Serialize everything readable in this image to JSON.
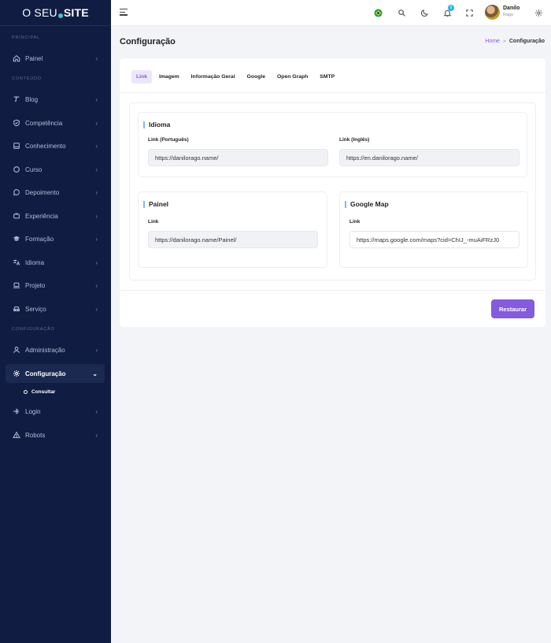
{
  "brand": {
    "part1": "O SEU",
    "part2": "SITE"
  },
  "sidebar": {
    "cat_principal": "PRINCIPAL",
    "cat_conteudo": "CONTEÚDO",
    "cat_configuracao": "CONFIGURAÇÃO",
    "items": [
      {
        "label": "Painel",
        "icon": "home-icon"
      },
      {
        "label": "Blog",
        "icon": "text-icon"
      },
      {
        "label": "Competência",
        "icon": "shield-icon"
      },
      {
        "label": "Conhecimento",
        "icon": "book-icon"
      },
      {
        "label": "Curso",
        "icon": "circle-icon"
      },
      {
        "label": "Depoimento",
        "icon": "chat-icon"
      },
      {
        "label": "Experiência",
        "icon": "briefcase-icon"
      },
      {
        "label": "Formação",
        "icon": "graduation-icon"
      },
      {
        "label": "Idioma",
        "icon": "translate-icon"
      },
      {
        "label": "Projeto",
        "icon": "laptop-icon"
      },
      {
        "label": "Serviço",
        "icon": "car-icon"
      },
      {
        "label": "Administração",
        "icon": "user-icon"
      },
      {
        "label": "Configuração",
        "icon": "gear-icon"
      },
      {
        "label": "Login",
        "icon": "login-icon"
      },
      {
        "label": "Robots",
        "icon": "warning-icon"
      }
    ],
    "sub_consultar": "Consultar"
  },
  "topbar": {
    "notif_count": "0",
    "user_name": "Danilo",
    "user_sub": "Rago"
  },
  "page": {
    "title": "Configuração",
    "breadcrumb_home": "Home",
    "breadcrumb_sep": "»",
    "breadcrumb_current": "Configuração"
  },
  "tabs": [
    "Link",
    "Imagem",
    "Informação Geral",
    "Google",
    "Open Graph",
    "SMTP"
  ],
  "sections": {
    "idioma": {
      "title": "Idioma",
      "label_pt": "Link (Português)",
      "value_pt": "https://danilorago.name/",
      "label_en": "Link (Inglês)",
      "value_en": "https://en.danilorago.name/"
    },
    "painel": {
      "title": "Painel",
      "label": "Link",
      "value": "https://danilorago.name/Painel/"
    },
    "google_map": {
      "title": "Google Map",
      "label": "Link",
      "value": "https://maps.google.com/maps?cid=ChIJ_-muAiFRzJ0"
    }
  },
  "buttons": {
    "restore": "Restaurar"
  },
  "colors": {
    "sidebar_bg": "#111c43",
    "accent": "#845adf",
    "badge": "#23b7e5"
  }
}
